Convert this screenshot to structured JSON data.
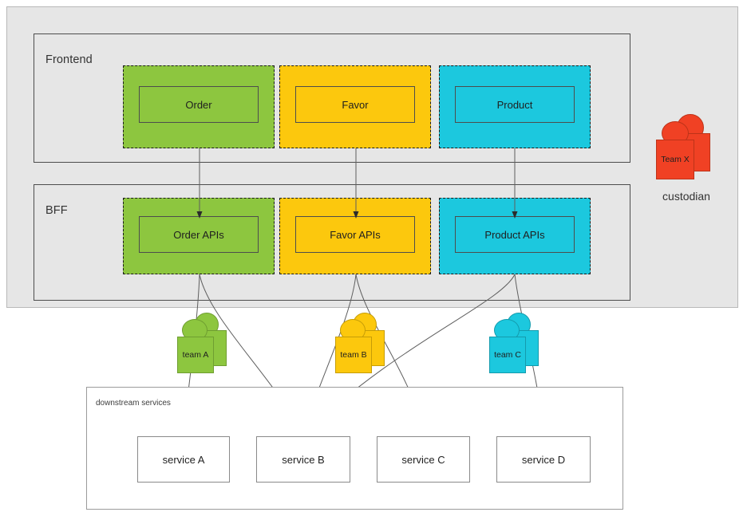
{
  "diagram": {
    "title_colors": {
      "green": "#8DC63F",
      "yellow": "#FCC80D",
      "cyan": "#1CC8DE",
      "red": "#F04124",
      "panel_gray": "#E6E6E6",
      "border_dark": "#4D4D4D"
    }
  },
  "layers": [
    {
      "id": "frontend",
      "label": "Frontend"
    },
    {
      "id": "bff",
      "label": "BFF"
    }
  ],
  "frontend_blocks": [
    {
      "label": "Order",
      "color": "#8DC63F"
    },
    {
      "label": "Favor",
      "color": "#FCC80D"
    },
    {
      "label": "Product",
      "color": "#1CC8DE"
    }
  ],
  "bff_blocks": [
    {
      "label": "Order APIs",
      "color": "#8DC63F"
    },
    {
      "label": "Favor APIs",
      "color": "#FCC80D"
    },
    {
      "label": "Product APIs",
      "color": "#1CC8DE"
    }
  ],
  "teams": [
    {
      "label": "team A",
      "color": "#8DC63F"
    },
    {
      "label": "team B",
      "color": "#FCC80D"
    },
    {
      "label": "team C",
      "color": "#1CC8DE"
    }
  ],
  "custodian": {
    "label": "Team X",
    "caption": "custodian",
    "color": "#F04124"
  },
  "downstream": {
    "title": "downstream services",
    "services": [
      {
        "label": "service A"
      },
      {
        "label": "service B"
      },
      {
        "label": "service C"
      },
      {
        "label": "service D"
      }
    ]
  },
  "connections": [
    {
      "from": "Order",
      "to": "Order APIs"
    },
    {
      "from": "Favor",
      "to": "Favor APIs"
    },
    {
      "from": "Product",
      "to": "Product APIs"
    },
    {
      "from": "Order APIs",
      "to": "service A"
    },
    {
      "from": "Order APIs",
      "to": "service B"
    },
    {
      "from": "Favor APIs",
      "to": "service B"
    },
    {
      "from": "Favor APIs",
      "to": "service C"
    },
    {
      "from": "Product APIs",
      "to": "service B"
    },
    {
      "from": "Product APIs",
      "to": "service D"
    }
  ]
}
